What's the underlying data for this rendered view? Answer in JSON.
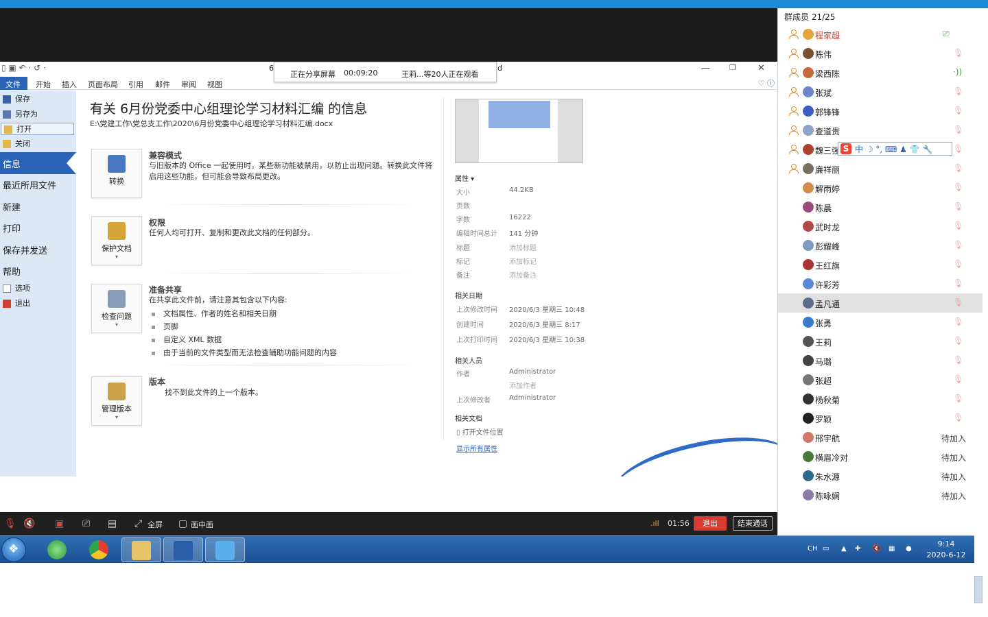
{
  "window": {
    "title_fragment_left": "6",
    "title_fragment_right": "d"
  },
  "sharing_banner": {
    "status": "正在分享屏幕",
    "elapsed": "00:09:20",
    "viewers": "王莉...等20人正在观看"
  },
  "ribbon": {
    "tabs": [
      "文件",
      "开始",
      "插入",
      "页面布局",
      "引用",
      "邮件",
      "审阅",
      "视图"
    ]
  },
  "backstage": {
    "small_items": [
      "保存",
      "另存为",
      "打开",
      "关闭"
    ],
    "active": "信息",
    "big_items": [
      "最近所用文件",
      "新建",
      "打印",
      "保存并发送",
      "帮助"
    ],
    "bottom_items": [
      "选项",
      "退出"
    ]
  },
  "info": {
    "title": "有关 6月份党委中心组理论学习材料汇编 的信息",
    "path": "E:\\党建工作\\党总支工作\\2020\\6月份党委中心组理论学习材料汇编.docx",
    "sections": [
      {
        "button": "转换",
        "heading": "兼容模式",
        "text": "与旧版本的 Office 一起使用时，某些新功能被禁用，以防止出现问题。转换此文件将启用这些功能，但可能会导致布局更改。"
      },
      {
        "button": "保护文档",
        "heading": "权限",
        "text": "任何人均可打开、复制和更改此文档的任何部分。"
      },
      {
        "button": "检查问题",
        "heading": "准备共享",
        "text": "在共享此文件前，请注意其包含以下内容:",
        "bullets": [
          "文档属性、作者的姓名和相关日期",
          "页脚",
          "自定义 XML 数据",
          "由于当前的文件类型而无法检查辅助功能问题的内容"
        ]
      },
      {
        "button": "管理版本",
        "heading": "版本",
        "text": "找不到此文件的上一个版本。"
      }
    ]
  },
  "properties": {
    "header": "属性 ▾",
    "rows": [
      {
        "label": "大小",
        "value": "44.2KB"
      },
      {
        "label": "页数",
        "value": ""
      },
      {
        "label": "字数",
        "value": "16222"
      },
      {
        "label": "编辑时间总计",
        "value": "141 分钟"
      },
      {
        "label": "标题",
        "value": "添加标题"
      },
      {
        "label": "标记",
        "value": "添加标记"
      },
      {
        "label": "备注",
        "value": "添加备注"
      }
    ],
    "dates_header": "相关日期",
    "dates": [
      {
        "label": "上次修改时间",
        "value": "2020/6/3 星期三 10:48"
      },
      {
        "label": "创建时间",
        "value": "2020/6/3 星期三 8:17"
      },
      {
        "label": "上次打印时间",
        "value": "2020/6/3 星期三 10:38"
      }
    ],
    "people_header": "相关人员",
    "author_label": "作者",
    "author": "Administrator",
    "add_author": "添加作者",
    "modifier_label": "上次修改者",
    "modifier": "Administrator",
    "docs_header": "相关文档",
    "open_location": "打开文件位置",
    "show_all": "显示所有属性"
  },
  "callbar": {
    "fullscreen": "全屏",
    "pip": "画中画",
    "timer": "01:56",
    "exit": "退出",
    "end": "结束通话"
  },
  "taskbar": {
    "tray_lang": "CH",
    "time": "9:14",
    "date": "2020-6-12"
  },
  "members": {
    "header": "群成员 21/25",
    "list": [
      {
        "name": "程家超",
        "admin": true,
        "state": "screen",
        "red": true
      },
      {
        "name": "陈伟",
        "admin": true,
        "state": "muted"
      },
      {
        "name": "梁西陈",
        "admin": true,
        "state": "speaking"
      },
      {
        "name": "张斌",
        "admin": true,
        "state": "muted"
      },
      {
        "name": "郭锋锋",
        "admin": true,
        "state": "muted"
      },
      {
        "name": "查道贵",
        "admin": true,
        "state": "muted"
      },
      {
        "name": "魏三强",
        "admin": true,
        "state": "muted"
      },
      {
        "name": "廉祥丽",
        "admin": true,
        "state": "muted"
      },
      {
        "name": "解雨婷",
        "admin": false,
        "state": "muted"
      },
      {
        "name": "陈晨",
        "admin": false,
        "state": "muted"
      },
      {
        "name": "武时龙",
        "admin": false,
        "state": "muted"
      },
      {
        "name": "彭耀峰",
        "admin": false,
        "state": "muted"
      },
      {
        "name": "王红旗",
        "admin": false,
        "state": "muted"
      },
      {
        "name": "许彩芳",
        "admin": false,
        "state": "muted"
      },
      {
        "name": "孟凡通",
        "admin": false,
        "state": "muted",
        "selected": true
      },
      {
        "name": "张勇",
        "admin": false,
        "state": "muted"
      },
      {
        "name": "王莉",
        "admin": false,
        "state": "muted"
      },
      {
        "name": "马璐",
        "admin": false,
        "state": "muted"
      },
      {
        "name": "张超",
        "admin": false,
        "state": "muted"
      },
      {
        "name": "杨秋菊",
        "admin": false,
        "state": "muted"
      },
      {
        "name": "罗颖",
        "admin": false,
        "state": "muted"
      },
      {
        "name": "邢宇航",
        "admin": false,
        "state": "待加入"
      },
      {
        "name": "横眉冷对",
        "admin": false,
        "state": "待加入"
      },
      {
        "name": "朱水源",
        "admin": false,
        "state": "待加入"
      },
      {
        "name": "陈咏娴",
        "admin": false,
        "state": "待加入"
      }
    ]
  },
  "ime": {
    "mode": "中"
  },
  "colors": {
    "accent": "#2a62b8",
    "exit": "#d93a32",
    "taskbar": "#1c4f93"
  }
}
